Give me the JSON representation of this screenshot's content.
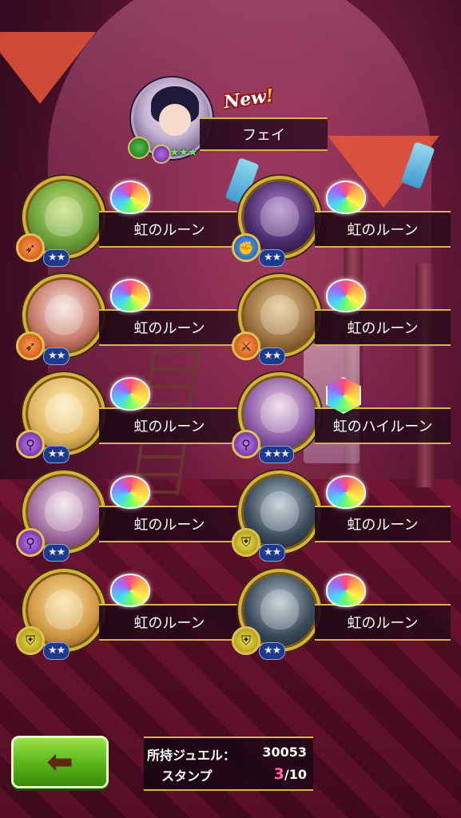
{
  "featured": {
    "badge": "New",
    "badge_mark": "!",
    "name": "フェイ",
    "class_icon": "bow-icon",
    "element_icon": "dark-element-icon",
    "stars": "★★★"
  },
  "rewards": [
    {
      "item": "虹のルーン",
      "stars": "★★",
      "class_icon": "bow-icon",
      "class_color": "orange",
      "portrait": "green-haired-archer"
    },
    {
      "item": "虹のルーン",
      "stars": "★★",
      "class_icon": "fist-icon",
      "class_color": "blue",
      "portrait": "dark-robot-knight"
    },
    {
      "item": "虹のルーン",
      "stars": "★★",
      "class_icon": "bow-icon",
      "class_color": "orange",
      "portrait": "white-owl-beast"
    },
    {
      "item": "虹のルーン",
      "stars": "★★",
      "class_icon": "sword-icon",
      "class_color": "orange",
      "portrait": "fox-beast"
    },
    {
      "item": "虹のルーン",
      "stars": "★★",
      "class_icon": "staff-icon",
      "class_color": "purple",
      "portrait": "blonde-girl"
    },
    {
      "item": "虹のハイルーン",
      "stars": "★★★",
      "class_icon": "staff-icon",
      "class_color": "purple",
      "portrait": "desert-queen"
    },
    {
      "item": "虹のルーン",
      "stars": "★★",
      "class_icon": "staff-icon",
      "class_color": "purple",
      "portrait": "white-cat-beast"
    },
    {
      "item": "虹のルーン",
      "stars": "★★",
      "class_icon": "shield-icon",
      "class_color": "yellow",
      "portrait": "black-cat-beast"
    },
    {
      "item": "虹のルーン",
      "stars": "★★",
      "class_icon": "shield-icon",
      "class_color": "yellow",
      "portrait": "eyepatch-blonde"
    },
    {
      "item": "虹のルーン",
      "stars": "★★",
      "class_icon": "shield-icon",
      "class_color": "yellow",
      "portrait": "black-cat-beast"
    }
  ],
  "footer": {
    "back_icon": "left-arrow-icon",
    "jewel_label": "所持ジュエル：",
    "jewel_value": "30053",
    "stamp_label": "スタンプ",
    "stamp_current": "3",
    "stamp_total": "/10"
  },
  "colors": {
    "accent_gold": "#d9b24a",
    "back_button": "#5cb81c",
    "stamp_highlight": "#ff6aa0"
  }
}
